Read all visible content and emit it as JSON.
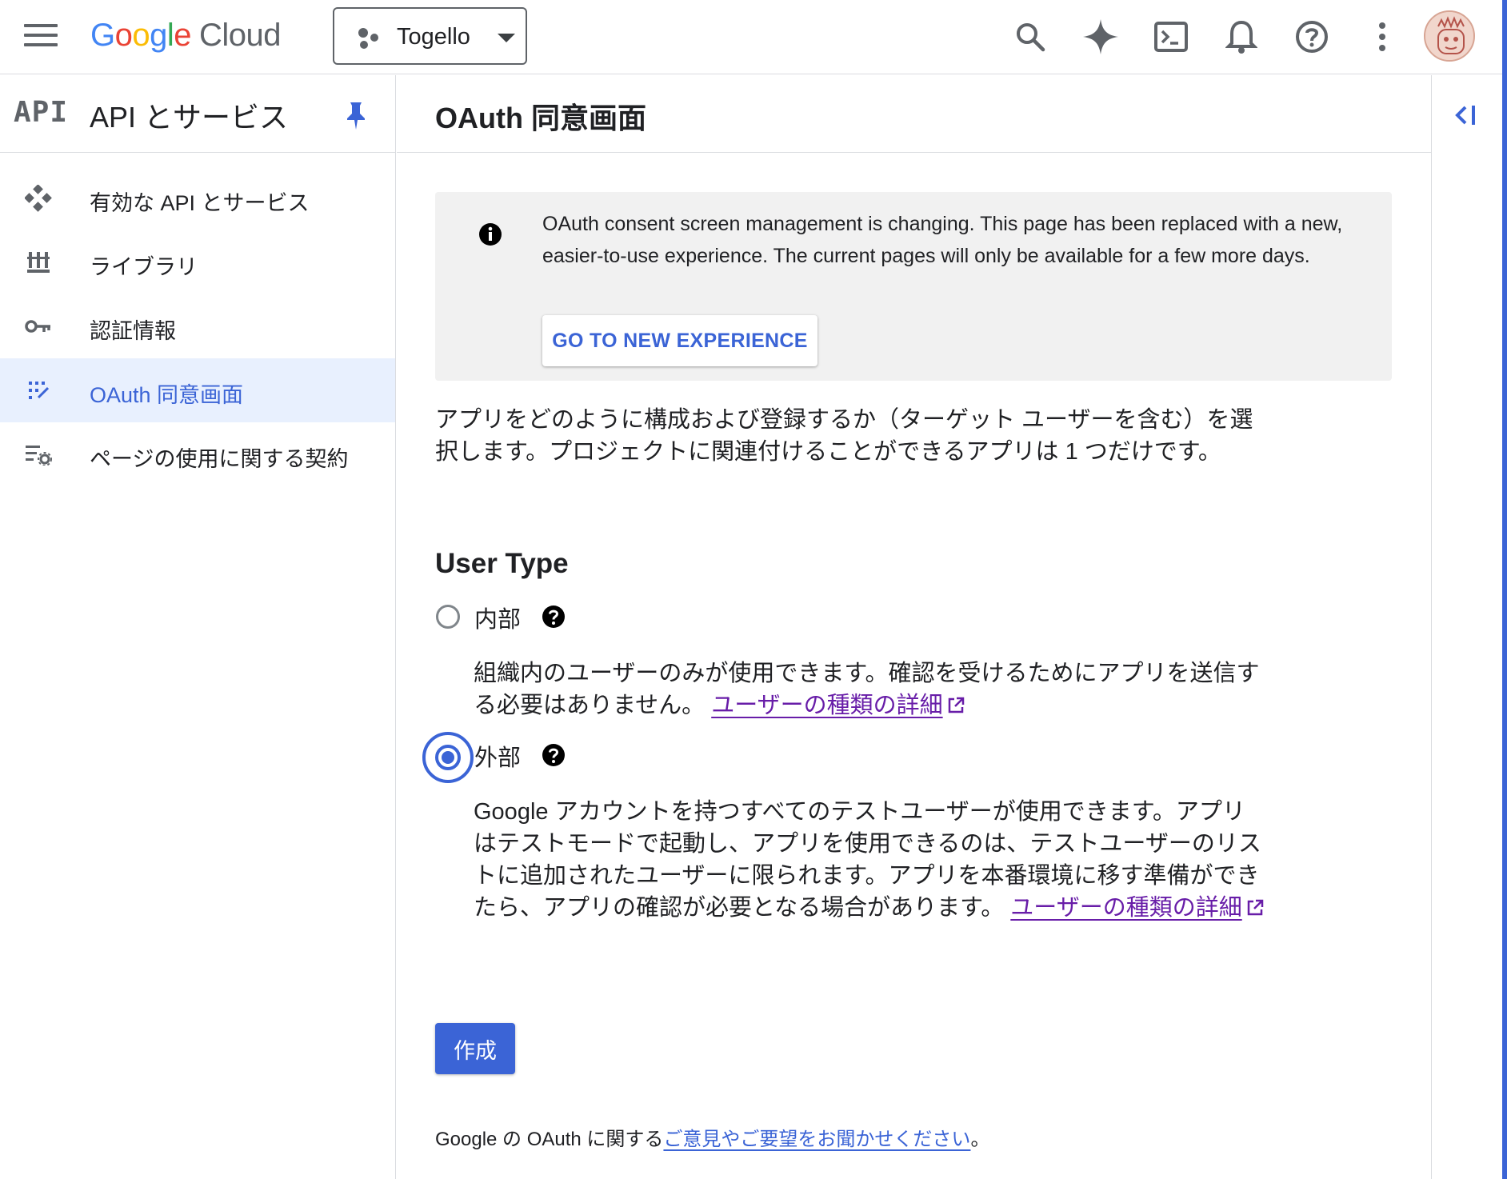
{
  "topbar": {
    "brand_letters": [
      "G",
      "o",
      "o",
      "g",
      "l",
      "e"
    ],
    "brand_product": "Cloud",
    "project_name": "Togello",
    "icons": [
      "menu-icon",
      "search-icon",
      "gemini-icon",
      "cloud-shell-icon",
      "notifications-icon",
      "help-icon",
      "more-vert-icon",
      "avatar"
    ]
  },
  "sidebar": {
    "logo_text": "API",
    "title": "API とサービス",
    "items": [
      {
        "label": "有効な API とサービス",
        "icon": "api-diamond-icon"
      },
      {
        "label": "ライブラリ",
        "icon": "library-icon"
      },
      {
        "label": "認証情報",
        "icon": "key-icon"
      },
      {
        "label": "OAuth 同意画面",
        "icon": "consent-icon",
        "active": true
      },
      {
        "label": "ページの使用に関する契約",
        "icon": "settings-list-icon"
      }
    ]
  },
  "main": {
    "title": "OAuth 同意画面",
    "banner": {
      "text": "OAuth consent screen management is changing. This page has been replaced with a new, easier-to-use experience. The current pages will only be available for a few more days.",
      "button": "GO TO NEW EXPERIENCE"
    },
    "description": "アプリをどのように構成および登録するか（ターゲット ユーザーを含む）を選択します。プロジェクトに関連付けることができるアプリは 1 つだけです。",
    "user_type_title": "User Type",
    "options": [
      {
        "label": "内部",
        "selected": false,
        "description": "組織内のユーザーのみが使用できます。確認を受けるためにアプリを送信する必要はありません。",
        "link": "ユーザーの種類の詳細"
      },
      {
        "label": "外部",
        "selected": true,
        "description": "Google アカウントを持つすべてのテストユーザーが使用できます。アプリはテストモードで起動し、アプリを使用できるのは、テストユーザーのリストに追加されたユーザーに限られます。アプリを本番環境に移す準備ができたら、アプリの確認が必要となる場合があります。",
        "link": "ユーザーの種類の詳細"
      }
    ],
    "create_button": "作成",
    "feedback_prefix": "Google の OAuth に関する",
    "feedback_link": "ご意見やご要望をお聞かせください",
    "feedback_suffix": "。"
  },
  "colors": {
    "accent": "#3b64d6",
    "link_visited": "#681da8",
    "active_bg": "#e8f0fe",
    "banner_bg": "#f1f1f1"
  }
}
